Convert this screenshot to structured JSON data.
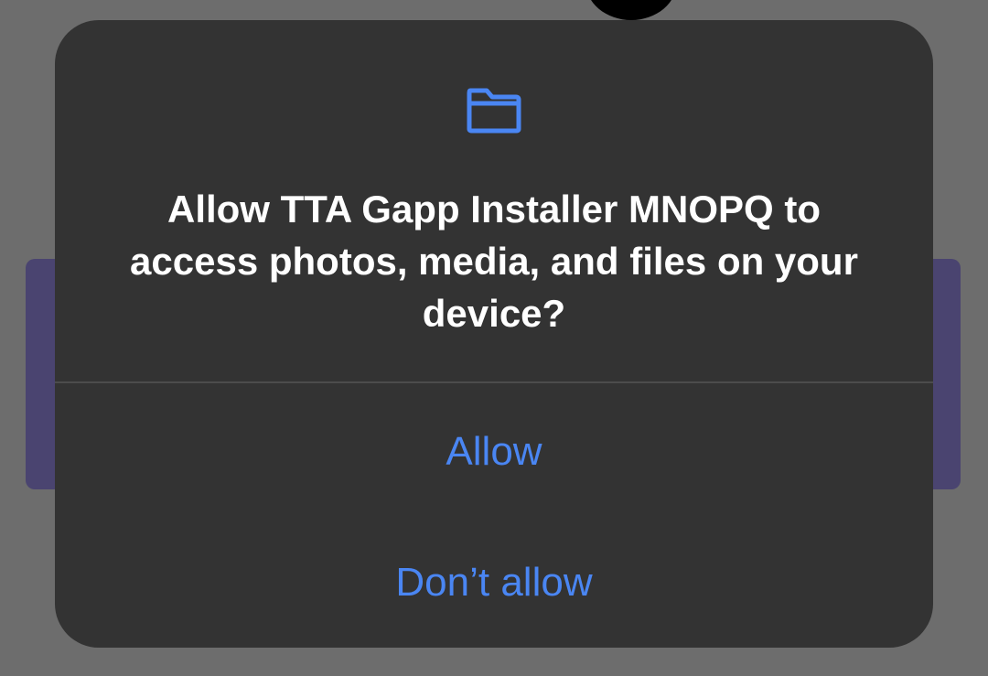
{
  "dialog": {
    "icon": "folder-icon",
    "title": "Allow TTA Gapp Installer MNOPQ to access photos, media, and files on your device?",
    "allow_label": "Allow",
    "deny_label": "Don’t allow"
  },
  "colors": {
    "scrim": "#6d6d6d",
    "dialog_bg": "#333333",
    "accent": "#4a86f3",
    "title_text": "#ffffff",
    "divider": "#4c4c4c",
    "background_card": "#4a4470"
  }
}
